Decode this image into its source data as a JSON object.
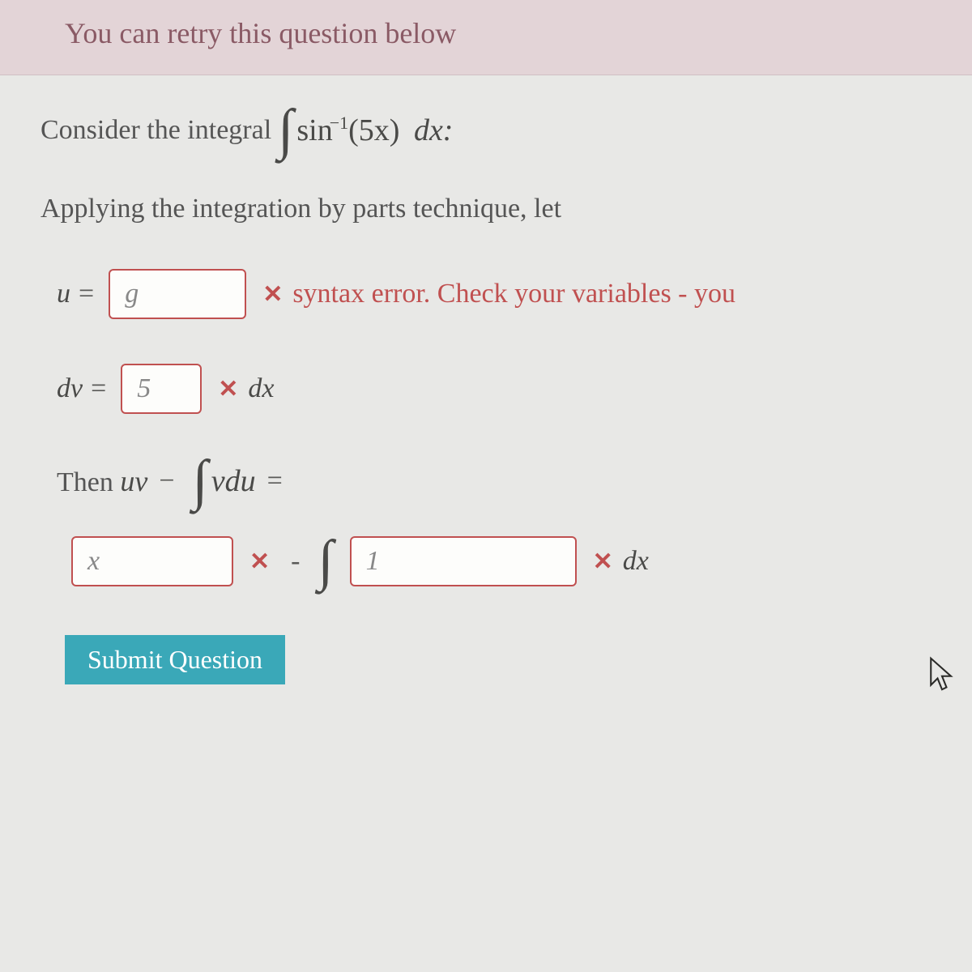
{
  "banner": {
    "text": "You can retry this question below"
  },
  "prompt": {
    "consider": "Consider the integral",
    "integral_func": "sin",
    "integral_exp": "−1",
    "integral_arg": "(5x)",
    "integral_dx": "dx:",
    "apply": "Applying the integration by parts technique, let"
  },
  "row_u": {
    "var": "u",
    "eq": "=",
    "value": "g",
    "error": "syntax error. Check your variables - you"
  },
  "row_dv": {
    "var": "dv",
    "eq": "=",
    "value": "5",
    "dx": "dx"
  },
  "row_then": {
    "text": "Then uv",
    "minus": "−",
    "int_body": "vdu",
    "eq": "="
  },
  "row_result": {
    "box1": "x",
    "minus": "-",
    "box2": "1",
    "dx": "dx"
  },
  "submit": {
    "label": "Submit Question"
  },
  "icons": {
    "wrong": "✕"
  }
}
